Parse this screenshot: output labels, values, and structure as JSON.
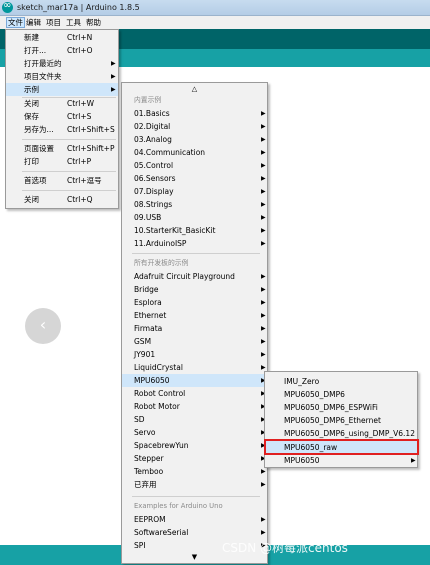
{
  "window": {
    "title": "sketch_mar17a | Arduino 1.8.5"
  },
  "menubar": {
    "file": "文件",
    "edit": "编辑",
    "project": "项目",
    "tools": "工具",
    "help": "帮助"
  },
  "file_menu": {
    "new": "新建",
    "new_sc": "Ctrl+N",
    "open": "打开...",
    "open_sc": "Ctrl+O",
    "open_recent": "打开最近的",
    "sketchbook": "项目文件夹",
    "examples": "示例",
    "close": "关闭",
    "close_sc": "Ctrl+W",
    "save": "保存",
    "save_sc": "Ctrl+S",
    "save_as": "另存为...",
    "save_as_sc": "Ctrl+Shift+S",
    "page_setup": "页面设置",
    "page_setup_sc": "Ctrl+Shift+P",
    "print": "打印",
    "print_sc": "Ctrl+P",
    "preferences": "首选项",
    "preferences_sc": "Ctrl+逗号",
    "quit": "关闭",
    "quit_sc": "Ctrl+Q"
  },
  "examples_menu": {
    "scroll_up": "△",
    "scroll_down": "▼",
    "builtin_header": "内置示例",
    "builtin": [
      "01.Basics",
      "02.Digital",
      "03.Analog",
      "04.Communication",
      "05.Control",
      "06.Sensors",
      "07.Display",
      "08.Strings",
      "09.USB",
      "10.StarterKit_BasicKit",
      "11.ArduinoISP"
    ],
    "all_boards_header": "所有开发板的示例",
    "libraries": [
      "Adafruit Circuit Playground",
      "Bridge",
      "Esplora",
      "Ethernet",
      "Firmata",
      "GSM",
      "JY901",
      "LiquidCrystal",
      "MPU6050",
      "Robot Control",
      "Robot Motor",
      "SD",
      "Servo",
      "SpacebrewYun",
      "Stepper",
      "Temboo",
      "已弃用"
    ],
    "uno_header": "Examples for Arduino Uno",
    "uno": [
      "EEPROM",
      "SoftwareSerial",
      "SPI"
    ]
  },
  "mpu_menu": {
    "items": [
      "IMU_Zero",
      "MPU6050_DMP6",
      "MPU6050_DMP6_ESPWiFi",
      "MPU6050_DMP6_Ethernet",
      "MPU6050_DMP6_using_DMP_V6.12",
      "MPU6050_raw",
      "MPU6050"
    ]
  },
  "nav": {
    "prev_glyph": "‹"
  },
  "watermark": "CSDN @树莓派centos",
  "colors": {
    "toolbar": "#006468",
    "tabs": "#17a1a5",
    "highlight": "#e02020",
    "selection": "#cfe6fa"
  }
}
